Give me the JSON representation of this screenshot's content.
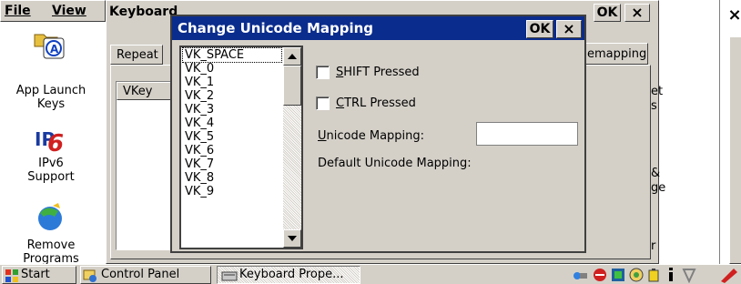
{
  "menu": {
    "file": "File",
    "view": "View"
  },
  "desktop_icons": [
    {
      "label_line1": "App Launch",
      "label_line2": "Keys",
      "icon": "app-launch-keys-icon"
    },
    {
      "label_line1": "IPv6",
      "label_line2": "Support",
      "icon": "ipv6-icon"
    },
    {
      "label_line1": "Remove",
      "label_line2": "Programs",
      "icon": "remove-programs-icon"
    }
  ],
  "keyboard_window": {
    "title": "Keyboard",
    "ok_label": "OK",
    "close_label": "×",
    "tab_repeat": "Repeat",
    "tab_remapping": "emapping",
    "column_vkey": "VKey",
    "right_fragments": [
      "et",
      "s",
      "&",
      "ge",
      "r"
    ]
  },
  "outer_close": "×",
  "dialog": {
    "title": "Change Unicode Mapping",
    "ok_label": "OK",
    "close_label": "×",
    "vkeys": [
      "VK_SPACE",
      "VK_0",
      "VK_1",
      "VK_2",
      "VK_3",
      "VK_4",
      "VK_5",
      "VK_6",
      "VK_7",
      "VK_8",
      "VK_9"
    ],
    "selected_vkey": "VK_SPACE",
    "shift_label": "SHIFT Pressed",
    "ctrl_label": "CTRL Pressed",
    "unicode_label": "Unicode Mapping:",
    "unicode_value": "",
    "default_label": "Default Unicode Mapping:",
    "default_value": ""
  },
  "taskbar": {
    "start": "Start",
    "control_panel": "Control Panel",
    "keyboard_props": "Keyboard Prope..."
  },
  "colors": {
    "title_bar": "#0a2c8c",
    "face": "#d4d0c8",
    "desktop": "#ffffff"
  }
}
